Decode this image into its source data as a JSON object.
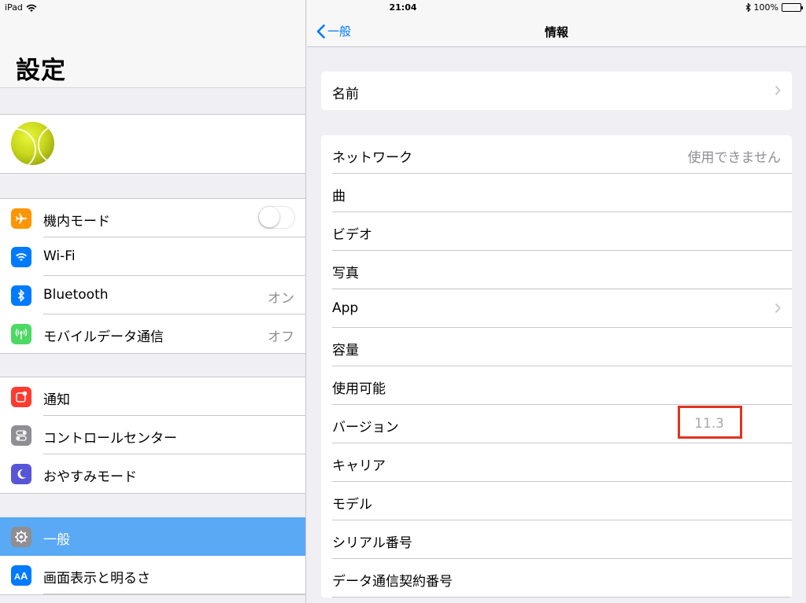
{
  "status_bar": {
    "device": "iPad",
    "time": "21:04",
    "battery": "100%"
  },
  "sidebar": {
    "title": "設定",
    "group1": [
      {
        "label": "機内モード",
        "icon": "airplane-icon",
        "color": "#ff9500",
        "control": "toggle",
        "toggle_on": false
      },
      {
        "label": "Wi-Fi",
        "icon": "wifi-icon",
        "color": "#007aff",
        "value": ""
      },
      {
        "label": "Bluetooth",
        "icon": "bluetooth-icon",
        "color": "#007aff",
        "value": "オン"
      },
      {
        "label": "モバイルデータ通信",
        "icon": "antenna-icon",
        "color": "#4cd964",
        "value": "オフ"
      }
    ],
    "group2": [
      {
        "label": "通知",
        "icon": "notification-icon",
        "color": "#ff3b30"
      },
      {
        "label": "コントロールセンター",
        "icon": "switches-icon",
        "color": "#8e8e93"
      },
      {
        "label": "おやすみモード",
        "icon": "moon-icon",
        "color": "#5856d6"
      }
    ],
    "group3": [
      {
        "label": "一般",
        "icon": "gear-icon",
        "color": "#8e8e93",
        "selected": true
      },
      {
        "label": "画面表示と明るさ",
        "icon": "text-size-icon",
        "color": "#007aff"
      }
    ]
  },
  "main": {
    "nav": {
      "back_label": "一般",
      "title": "情報"
    },
    "card1": [
      {
        "label": "名前",
        "value": "",
        "chevron": true
      }
    ],
    "card2": [
      {
        "label": "ネットワーク",
        "value": "使用できません",
        "chevron": false
      },
      {
        "label": "曲",
        "value": "",
        "chevron": false
      },
      {
        "label": "ビデオ",
        "value": "",
        "chevron": false
      },
      {
        "label": "写真",
        "value": "",
        "chevron": false
      },
      {
        "label": "App",
        "value": "",
        "chevron": true
      },
      {
        "label": "容量",
        "value": "",
        "chevron": false
      },
      {
        "label": "使用可能",
        "value": "",
        "chevron": false
      },
      {
        "label": "バージョン",
        "value": "11.3",
        "chevron": false
      },
      {
        "label": "キャリア",
        "value": "",
        "chevron": false
      },
      {
        "label": "モデル",
        "value": "",
        "chevron": false
      },
      {
        "label": "シリアル番号",
        "value": "",
        "chevron": false
      },
      {
        "label": "データ通信契約番号",
        "value": "",
        "chevron": false
      }
    ],
    "highlight_color": "#e0341e"
  }
}
